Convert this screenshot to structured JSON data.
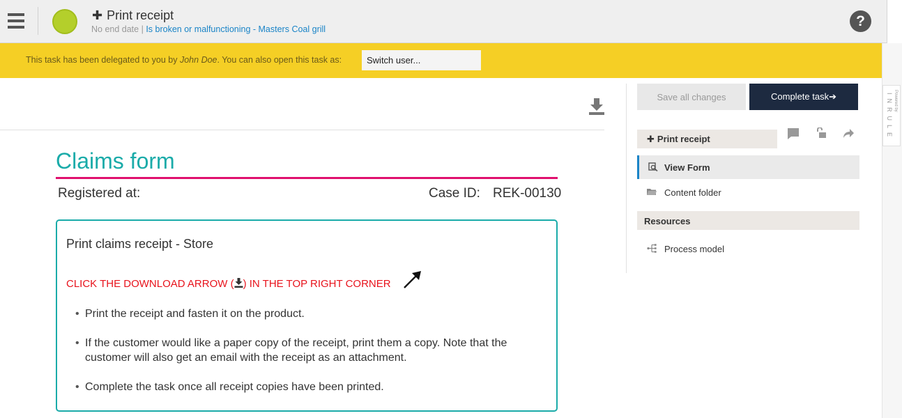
{
  "header": {
    "task_title": "Print receipt",
    "no_end_date": "No end date",
    "separator": "|",
    "case_link": "Is broken or malfunctioning - Masters Coal grill",
    "help_label": "?",
    "status_color": "#b4cf2b"
  },
  "banner": {
    "text_before": "This task has been delegated to you by ",
    "delegator": "John Doe",
    "text_after": ". You can also open this task as:",
    "switch_placeholder": "Switch user..."
  },
  "side_strip": {
    "powered_by": "Powered by",
    "brand": "INRULE"
  },
  "form": {
    "title": "Claims form",
    "registered_label": "Registered at:",
    "case_id_label": "Case ID:",
    "case_id_value": "REK-00130",
    "card": {
      "title": "Print claims receipt - Store",
      "warning_before": "CLICK THE DOWNLOAD ARROW (",
      "warning_after": ") IN THE TOP RIGHT CORNER",
      "items": [
        "Print the receipt and fasten it on the product.",
        "If the customer would like a paper copy of the receipt, print them a copy. Note that the customer will also get an email with the receipt as an attachment.",
        "Complete the task once all receipt copies have been printed."
      ]
    }
  },
  "actions": {
    "save_label": "Save all changes",
    "complete_label": "Complete task",
    "complete_arrow": "➔"
  },
  "panel": {
    "task_tag": "Print receipt",
    "nav": [
      {
        "label": "View Form",
        "icon": "view-form-icon",
        "active": true
      },
      {
        "label": "Content folder",
        "icon": "folder-icon",
        "active": false
      }
    ],
    "resources_header": "Resources",
    "resources": [
      {
        "label": "Process model",
        "icon": "process-model-icon"
      }
    ]
  },
  "colors": {
    "accent_teal": "#1aaba9",
    "accent_magenta": "#e0106e",
    "banner_yellow": "#f5cf25",
    "primary_button": "#1d2a40",
    "warning_red": "#e8131c",
    "link_blue": "#1a84c7"
  }
}
